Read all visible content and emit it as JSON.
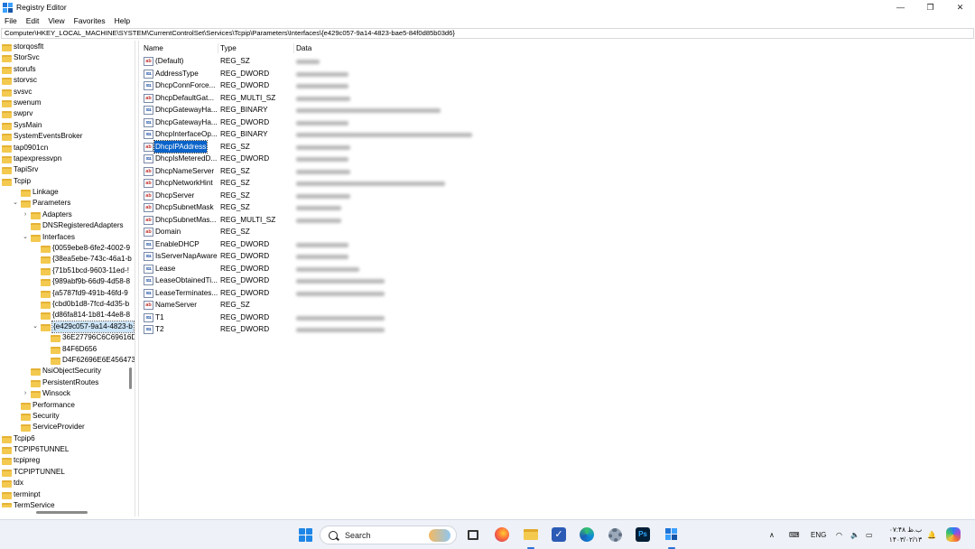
{
  "window": {
    "title": "Registry Editor",
    "minimize_glyph": "—",
    "maximize_glyph": "❐",
    "close_glyph": "✕"
  },
  "menu": [
    "File",
    "Edit",
    "View",
    "Favorites",
    "Help"
  ],
  "address": "Computer\\HKEY_LOCAL_MACHINE\\SYSTEM\\CurrentControlSet\\Services\\Tcpip\\Parameters\\Interfaces\\{e429c057-9a14-4823-bae5-84f0d85b03d6}",
  "tree": [
    {
      "label": "storqosflt",
      "indent": 0,
      "exp": ""
    },
    {
      "label": "StorSvc",
      "indent": 0,
      "exp": ""
    },
    {
      "label": "storufs",
      "indent": 0,
      "exp": ""
    },
    {
      "label": "storvsc",
      "indent": 0,
      "exp": ""
    },
    {
      "label": "svsvc",
      "indent": 0,
      "exp": ""
    },
    {
      "label": "swenum",
      "indent": 0,
      "exp": ""
    },
    {
      "label": "swprv",
      "indent": 0,
      "exp": ""
    },
    {
      "label": "SysMain",
      "indent": 0,
      "exp": ""
    },
    {
      "label": "SystemEventsBroker",
      "indent": 0,
      "exp": ""
    },
    {
      "label": "tap0901cn",
      "indent": 0,
      "exp": ""
    },
    {
      "label": "tapexpressvpn",
      "indent": 0,
      "exp": ""
    },
    {
      "label": "TapiSrv",
      "indent": 0,
      "exp": ""
    },
    {
      "label": "Tcpip",
      "indent": 0,
      "exp": "v"
    },
    {
      "label": "Linkage",
      "indent": 1,
      "exp": ""
    },
    {
      "label": "Parameters",
      "indent": 1,
      "exp": "v"
    },
    {
      "label": "Adapters",
      "indent": 2,
      "exp": ">"
    },
    {
      "label": "DNSRegisteredAdapters",
      "indent": 2,
      "exp": ""
    },
    {
      "label": "Interfaces",
      "indent": 2,
      "exp": "v"
    },
    {
      "label": "{0059ebe8-6fe2-4002-9",
      "indent": 3,
      "exp": ""
    },
    {
      "label": "{38ea5ebe-743c-46a1-b",
      "indent": 3,
      "exp": ""
    },
    {
      "label": "{71b51bcd-9603-11ed-!",
      "indent": 3,
      "exp": ""
    },
    {
      "label": "{989abf9b-66d9-4d58-8",
      "indent": 3,
      "exp": ""
    },
    {
      "label": "{a5787fd9-491b-46fd-9",
      "indent": 3,
      "exp": ""
    },
    {
      "label": "{cbd0b1d8-7fcd-4d35-b",
      "indent": 3,
      "exp": ""
    },
    {
      "label": "{d86fa814-1b81-44e8-8",
      "indent": 3,
      "exp": ""
    },
    {
      "label": "{e429c057-9a14-4823-b",
      "indent": 3,
      "exp": "v",
      "selected": true
    },
    {
      "label": "36E27796C6C69616D",
      "indent": 4,
      "exp": ""
    },
    {
      "label": "84F6D656",
      "indent": 4,
      "exp": ""
    },
    {
      "label": "D4F62696E6E456473",
      "indent": 4,
      "exp": ""
    },
    {
      "label": "NsiObjectSecurity",
      "indent": 2,
      "exp": ""
    },
    {
      "label": "PersistentRoutes",
      "indent": 2,
      "exp": ""
    },
    {
      "label": "Winsock",
      "indent": 2,
      "exp": ">"
    },
    {
      "label": "Performance",
      "indent": 1,
      "exp": ""
    },
    {
      "label": "Security",
      "indent": 1,
      "exp": ""
    },
    {
      "label": "ServiceProvider",
      "indent": 1,
      "exp": ""
    },
    {
      "label": "Tcpip6",
      "indent": 0,
      "exp": ""
    },
    {
      "label": "TCPIP6TUNNEL",
      "indent": 0,
      "exp": ""
    },
    {
      "label": "tcpipreg",
      "indent": 0,
      "exp": ""
    },
    {
      "label": "TCPIPTUNNEL",
      "indent": 0,
      "exp": ""
    },
    {
      "label": "tdx",
      "indent": 0,
      "exp": ""
    },
    {
      "label": "terminpt",
      "indent": 0,
      "exp": ""
    },
    {
      "label": "TermService",
      "indent": 0,
      "exp": ""
    }
  ],
  "columns": {
    "name": "Name",
    "type": "Type",
    "data": "Data"
  },
  "values": [
    {
      "name": "(Default)",
      "type": "REG_SZ",
      "kind": "str",
      "data_len": 26
    },
    {
      "name": "AddressType",
      "type": "REG_DWORD",
      "kind": "bin",
      "data_len": 58
    },
    {
      "name": "DhcpConnForce...",
      "type": "REG_DWORD",
      "kind": "bin",
      "data_len": 58
    },
    {
      "name": "DhcpDefaultGat...",
      "type": "REG_MULTI_SZ",
      "kind": "str",
      "data_len": 60
    },
    {
      "name": "DhcpGatewayHa...",
      "type": "REG_BINARY",
      "kind": "bin",
      "data_len": 160
    },
    {
      "name": "DhcpGatewayHa...",
      "type": "REG_DWORD",
      "kind": "bin",
      "data_len": 58
    },
    {
      "name": "DhcpInterfaceOp...",
      "type": "REG_BINARY",
      "kind": "bin",
      "data_len": 195
    },
    {
      "name": "DhcpIPAddress",
      "type": "REG_SZ",
      "kind": "str",
      "data_len": 60,
      "selected": true
    },
    {
      "name": "DhcpIsMeteredD...",
      "type": "REG_DWORD",
      "kind": "bin",
      "data_len": 58
    },
    {
      "name": "DhcpNameServer",
      "type": "REG_SZ",
      "kind": "str",
      "data_len": 60
    },
    {
      "name": "DhcpNetworkHint",
      "type": "REG_SZ",
      "kind": "str",
      "data_len": 165
    },
    {
      "name": "DhcpServer",
      "type": "REG_SZ",
      "kind": "str",
      "data_len": 60
    },
    {
      "name": "DhcpSubnetMask",
      "type": "REG_SZ",
      "kind": "str",
      "data_len": 50
    },
    {
      "name": "DhcpSubnetMas...",
      "type": "REG_MULTI_SZ",
      "kind": "str",
      "data_len": 50
    },
    {
      "name": "Domain",
      "type": "REG_SZ",
      "kind": "str",
      "data_len": 0
    },
    {
      "name": "EnableDHCP",
      "type": "REG_DWORD",
      "kind": "bin",
      "data_len": 58
    },
    {
      "name": "IsServerNapAware",
      "type": "REG_DWORD",
      "kind": "bin",
      "data_len": 58
    },
    {
      "name": "Lease",
      "type": "REG_DWORD",
      "kind": "bin",
      "data_len": 70
    },
    {
      "name": "LeaseObtainedTi...",
      "type": "REG_DWORD",
      "kind": "bin",
      "data_len": 98
    },
    {
      "name": "LeaseTerminates...",
      "type": "REG_DWORD",
      "kind": "bin",
      "data_len": 98
    },
    {
      "name": "NameServer",
      "type": "REG_SZ",
      "kind": "str",
      "data_len": 0
    },
    {
      "name": "T1",
      "type": "REG_DWORD",
      "kind": "bin",
      "data_len": 98
    },
    {
      "name": "T2",
      "type": "REG_DWORD",
      "kind": "bin",
      "data_len": 98
    }
  ],
  "taskbar": {
    "search_label": "Search",
    "tray_lang": "ENG",
    "clock_time": "ب.ظ ۰۷:۴۸",
    "clock_date": "۱۴۰۳/۰۲/۱۳"
  },
  "colors": {
    "selection": "#0a63c9",
    "folder": "#f3c94f",
    "accent": "#1e86e6"
  }
}
